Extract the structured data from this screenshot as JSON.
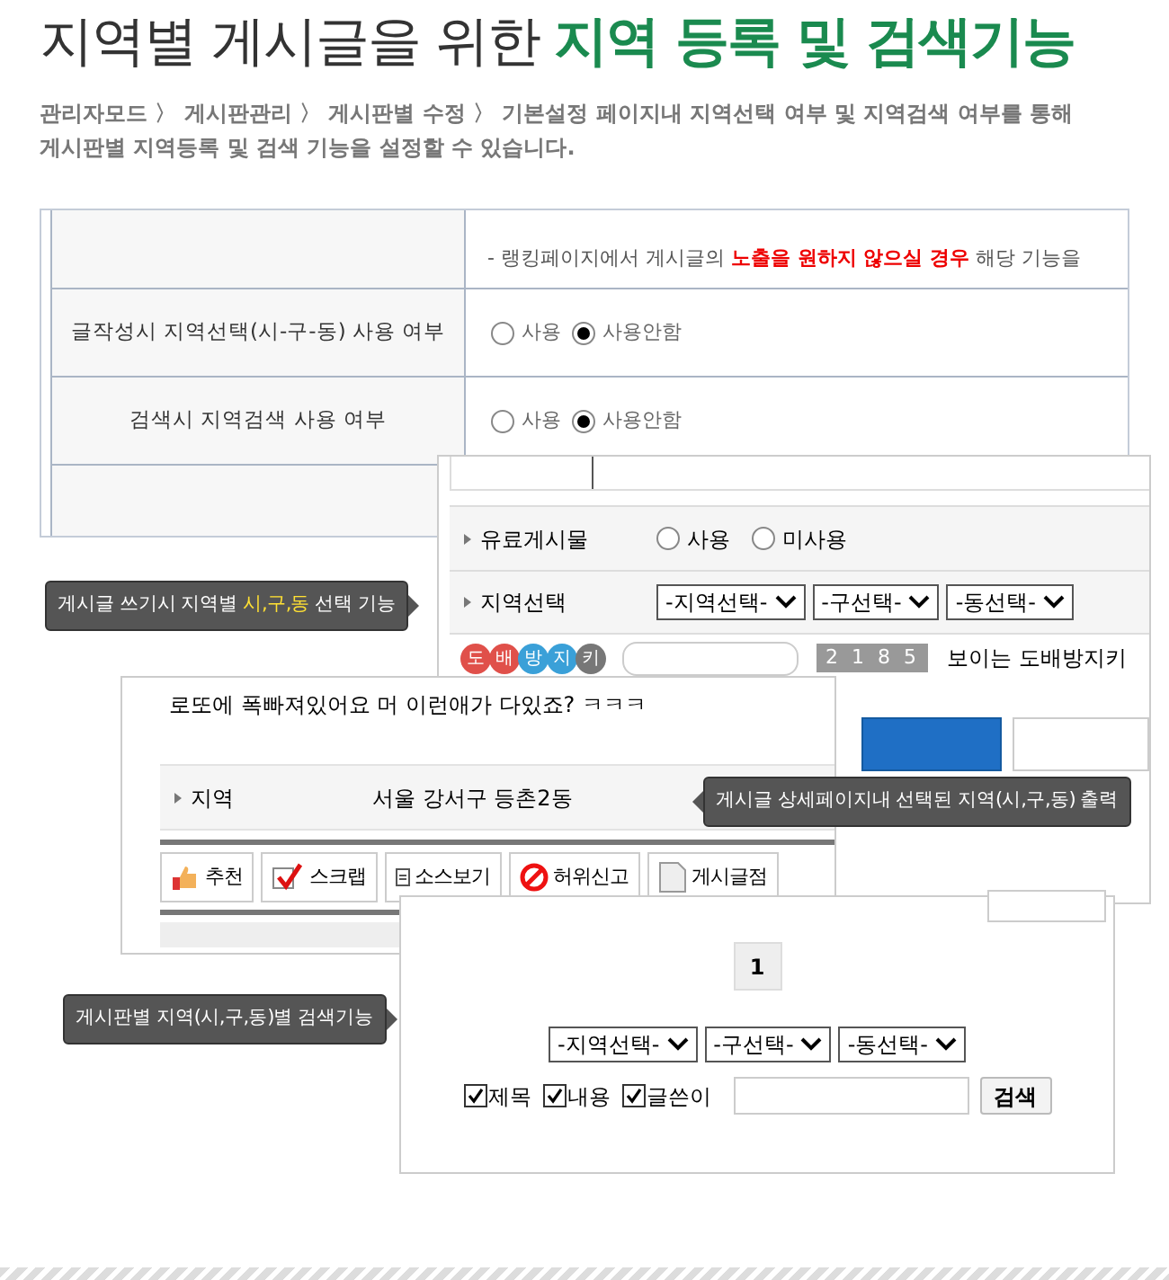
{
  "header": {
    "title": "지역별 게시글을 위한",
    "title_highlight": "지역 등록 및 검색기능",
    "description": [
      "관리자모드 〉 게시판관리 〉 게시판별 수정 〉 기본설정 페이지내 지역선택 여부 및 지역검색 여부를 통해",
      "게시판별 지역등록 및 검색 기능을 설정할 수 있습니다."
    ]
  },
  "settings_panel": {
    "note": "- 랭킹페이지에서 게시글의 **노출을 원하지 않으실 경우** 해당 기능을",
    "rows": [
      {
        "label": "글작성시 지역선택(시-구-동) 사용 여부",
        "options": [
          {
            "label": "사용",
            "selected": false
          },
          {
            "label": "사용안함",
            "selected": true
          }
        ]
      },
      {
        "label": "검색시 지역검색 사용 여부",
        "options": [
          {
            "label": "사용",
            "selected": false
          },
          {
            "label": "사용안함",
            "selected": true
          }
        ]
      }
    ]
  },
  "write_panel": {
    "paid_label": "유료게시물",
    "paid_options": [
      {
        "label": "사용",
        "selected": false
      },
      {
        "label": "미사용",
        "selected": false
      }
    ],
    "region_label": "지역선택",
    "selects": [
      "-지역선택-",
      "-구선택-",
      "-동선택-"
    ],
    "captcha_chars": [
      {
        "char": "도",
        "color": "#e0504a"
      },
      {
        "char": "배",
        "color": "#e0504a"
      },
      {
        "char": "방",
        "color": "#3aa0d8"
      },
      {
        "char": "지",
        "color": "#3aa0d8"
      },
      {
        "char": "키",
        "color": "#777777"
      }
    ],
    "captcha_code": "2 1 8 5",
    "captcha_hint": "보이는 도배방지키"
  },
  "view_panel": {
    "content": "로또에 폭빠져있어요 머 이런애가 다있죠? ㅋㅋㅋ",
    "region_label": "지역",
    "region_value": "서울 강서구 등촌2동",
    "buttons": [
      {
        "kind": "thumb",
        "label": "추천"
      },
      {
        "kind": "check",
        "label": "스크랩"
      },
      {
        "kind": "doc",
        "label": "소스보기"
      },
      {
        "kind": "ban",
        "label": "허위신고"
      },
      {
        "kind": "page",
        "label": "게시글점"
      }
    ]
  },
  "search_panel": {
    "page": "1",
    "selects": [
      "-지역선택-",
      "-구선택-",
      "-동선택-"
    ],
    "checks": [
      {
        "label": "제목",
        "checked": true
      },
      {
        "label": "내용",
        "checked": true
      },
      {
        "label": "글쓴이",
        "checked": true
      }
    ],
    "search_button": "검색"
  },
  "callouts": [
    {
      "text": "게시글 쓰기시 지역별 **시,구,동** 선택 기능",
      "kind": "right"
    },
    {
      "text": "게시글 상세페이지내 선택된 지역(시,구,동) 출력",
      "kind": "left"
    },
    {
      "text": "게시판별 지역(시,구,동)별 검색기능",
      "kind": "right"
    }
  ]
}
